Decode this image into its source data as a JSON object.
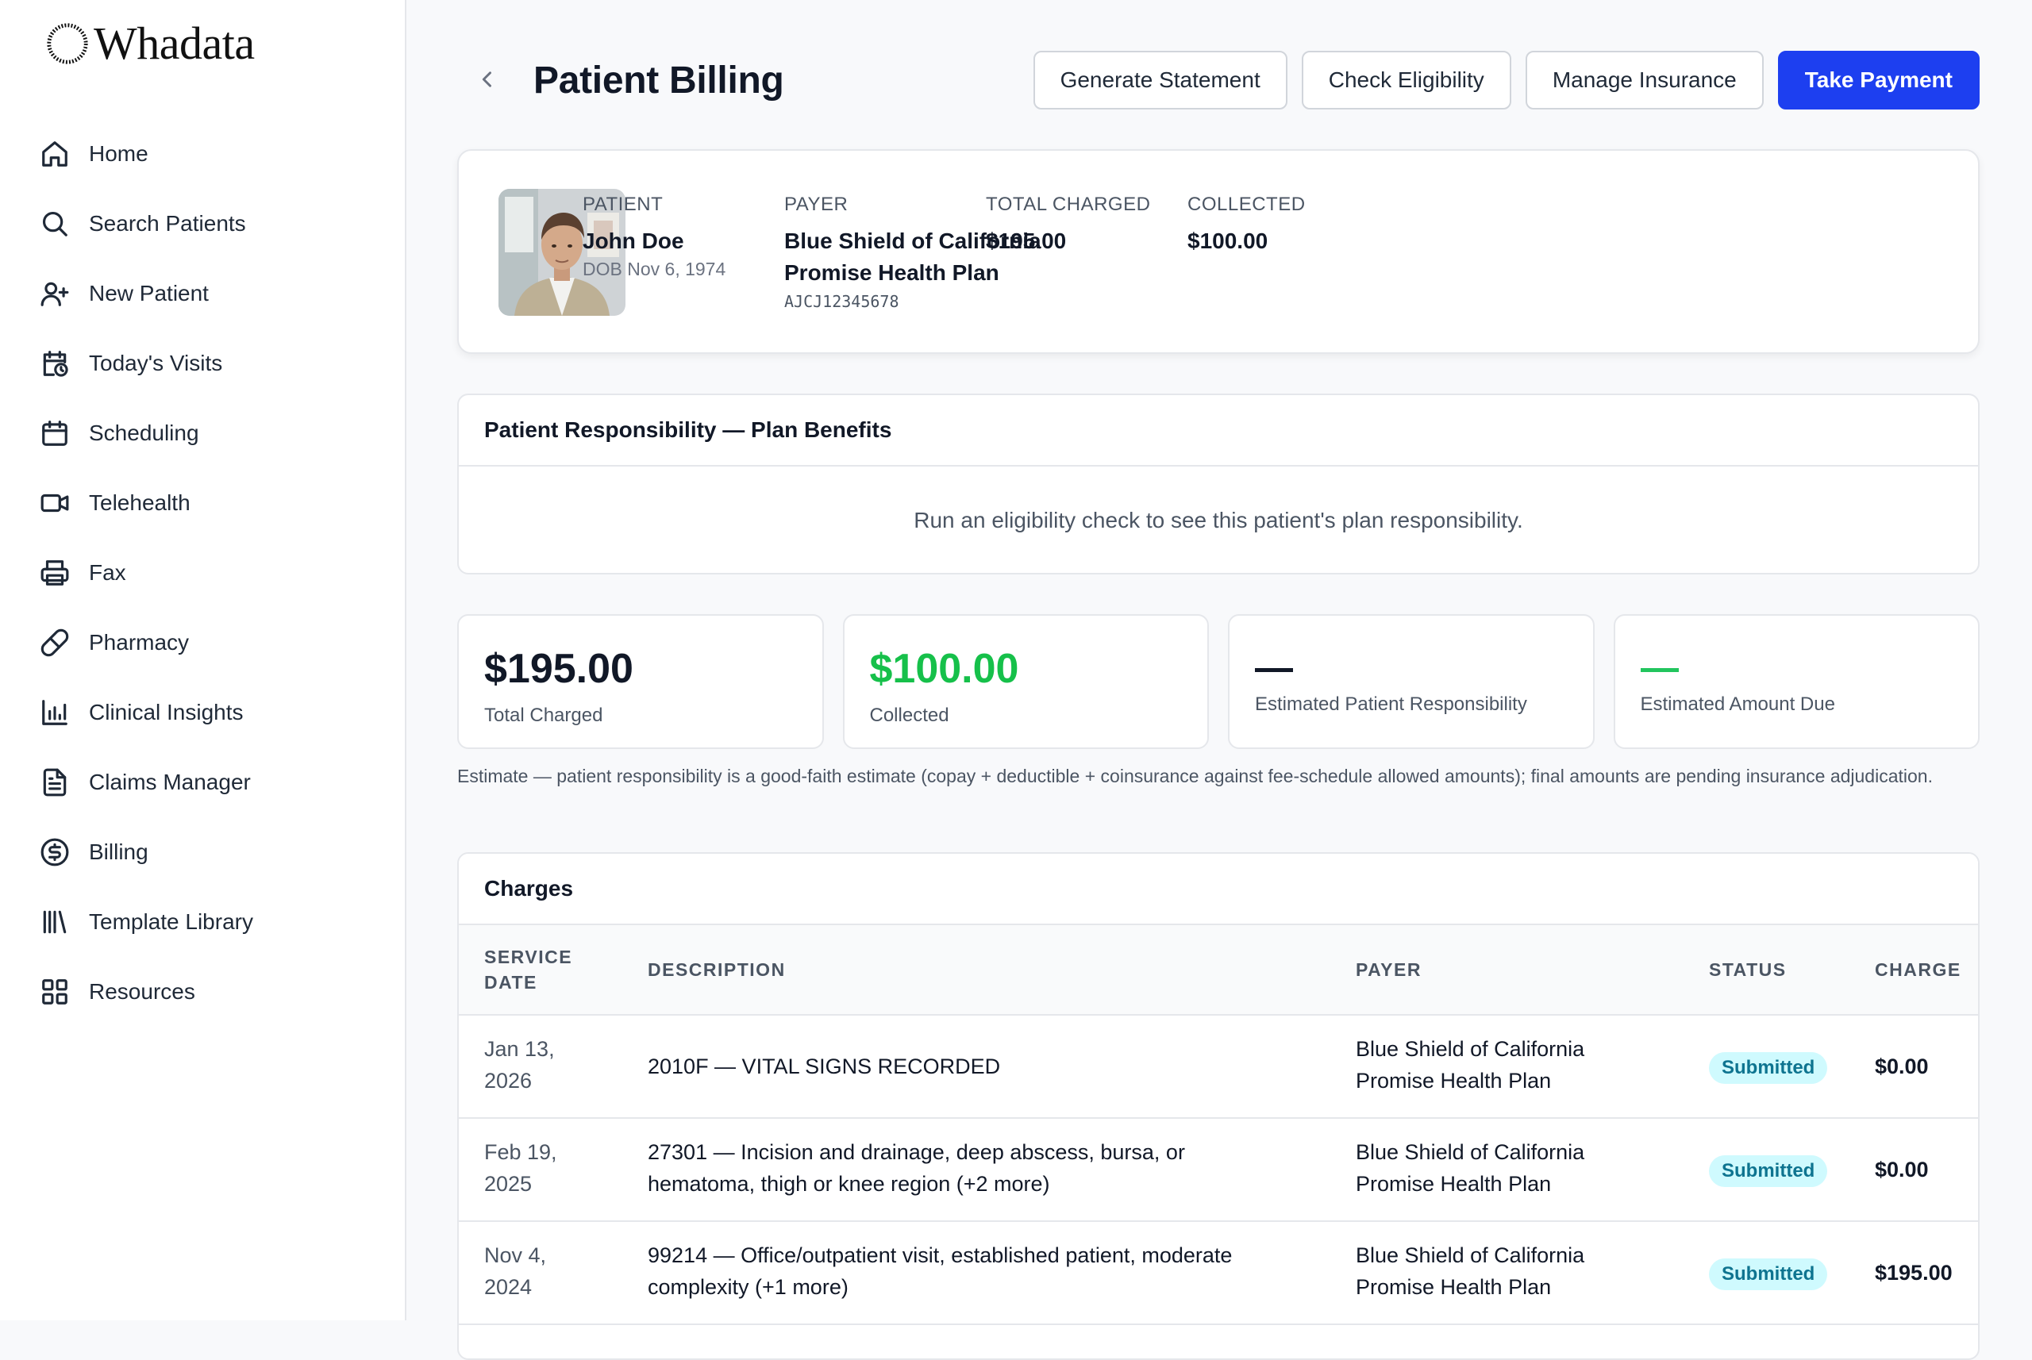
{
  "app": {
    "brand": "Whadata"
  },
  "sidebar": {
    "items": [
      {
        "label": "Home",
        "icon": "home-icon"
      },
      {
        "label": "Search Patients",
        "icon": "search-icon"
      },
      {
        "label": "New Patient",
        "icon": "user-plus-icon"
      },
      {
        "label": "Today's Visits",
        "icon": "calendar-clock-icon"
      },
      {
        "label": "Scheduling",
        "icon": "calendar-icon"
      },
      {
        "label": "Telehealth",
        "icon": "video-icon"
      },
      {
        "label": "Fax",
        "icon": "printer-icon"
      },
      {
        "label": "Pharmacy",
        "icon": "pill-icon"
      },
      {
        "label": "Clinical Insights",
        "icon": "bar-chart-icon"
      },
      {
        "label": "Claims Manager",
        "icon": "document-icon"
      },
      {
        "label": "Billing",
        "icon": "dollar-circle-icon"
      },
      {
        "label": "Template Library",
        "icon": "library-icon"
      },
      {
        "label": "Resources",
        "icon": "grid-icon"
      }
    ]
  },
  "header": {
    "title": "Patient Billing",
    "actions": {
      "generate_statement": "Generate Statement",
      "check_eligibility": "Check Eligibility",
      "manage_insurance": "Manage Insurance",
      "take_payment": "Take Payment"
    }
  },
  "patient": {
    "patient_label": "PATIENT",
    "name": "John Doe",
    "dob": "DOB Nov 6, 1974",
    "payer_label": "PAYER",
    "payer_line1": "Blue Shield of California",
    "payer_line2": "Promise Health Plan",
    "member_id": "AJCJ12345678",
    "total_charged_label": "TOTAL CHARGED",
    "total_charged": "$195.00",
    "collected_label": "COLLECTED",
    "collected": "$100.00"
  },
  "benefits": {
    "title": "Patient Responsibility — Plan Benefits",
    "message": "Run an eligibility check to see this patient's plan responsibility."
  },
  "stats": {
    "total_charged": {
      "value": "$195.00",
      "caption": "Total Charged"
    },
    "collected": {
      "value": "$100.00",
      "caption": "Collected"
    },
    "est_patient_resp": {
      "caption": "Estimated Patient Responsibility"
    },
    "est_amount_due": {
      "caption": "Estimated Amount Due"
    }
  },
  "estimate_note": "Estimate — patient responsibility is a good-faith estimate (copay + deductible + coinsurance against fee-schedule allowed amounts); final amounts are pending insurance adjudication.",
  "charges": {
    "title": "Charges",
    "columns": {
      "service_date_1": "SERVICE",
      "service_date_2": "DATE",
      "description": "DESCRIPTION",
      "payer": "PAYER",
      "status": "STATUS",
      "charge": "CHARGE"
    },
    "rows": [
      {
        "date_1": "Jan 13,",
        "date_2": "2026",
        "desc_1": "2010F — VITAL SIGNS RECORDED",
        "desc_2": "",
        "payer_1": "Blue Shield of California",
        "payer_2": "Promise Health Plan",
        "status": "Submitted",
        "charge": "$0.00"
      },
      {
        "date_1": "Feb 19,",
        "date_2": "2025",
        "desc_1": "27301 — Incision and drainage, deep abscess, bursa, or",
        "desc_2": "hematoma, thigh or knee region (+2 more)",
        "payer_1": "Blue Shield of California",
        "payer_2": "Promise Health Plan",
        "status": "Submitted",
        "charge": "$0.00"
      },
      {
        "date_1": "Nov 4,",
        "date_2": "2024",
        "desc_1": "99214 — Office/outpatient visit, established patient, moderate",
        "desc_2": "complexity (+1 more)",
        "payer_1": "Blue Shield of California",
        "payer_2": "Promise Health Plan",
        "status": "Submitted",
        "charge": "$195.00"
      }
    ]
  },
  "colors": {
    "primary": "#1d3ff0",
    "collected_green": "#16c04a",
    "badge_bg": "#cffafe",
    "badge_text": "#0e7490"
  }
}
